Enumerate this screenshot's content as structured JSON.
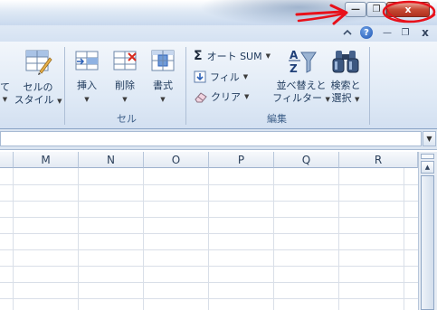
{
  "window": {
    "minimize_glyph": "—",
    "restore_glyph": "❐",
    "close_glyph": "x"
  },
  "ribbon_controls": {
    "help_glyph": "?",
    "minimize_glyph": "—",
    "restore_glyph": "❐",
    "close_glyph": "x"
  },
  "ribbon": {
    "styles_group": {
      "partial_label": "て",
      "cell_style": {
        "line1": "セルの",
        "line2": "スタイル"
      }
    },
    "cells_group": {
      "label": "セル",
      "insert": "挿入",
      "delete": "削除",
      "format": "書式"
    },
    "editing_group": {
      "label": "編集",
      "autosum": "オート SUM",
      "fill": "フィル",
      "clear": "クリア",
      "sort_filter": {
        "line1": "並べ替えと",
        "line2": "フィルター"
      },
      "find_select": {
        "line1": "検索と",
        "line2": "選択"
      }
    }
  },
  "sheet": {
    "columns": [
      "M",
      "N",
      "O",
      "P",
      "Q",
      "R"
    ]
  },
  "colors": {
    "annotation_red": "#e8101a",
    "close_button": "#c74a34",
    "ribbon_bg": "#dde8f5",
    "accent_blue": "#1f56b4"
  },
  "icons": {
    "cell_style": "cell-style-icon",
    "insert": "insert-cells-icon",
    "delete": "delete-cells-icon",
    "format": "format-cells-icon",
    "autosum": "sigma-icon",
    "fill": "fill-down-icon",
    "clear": "eraser-icon",
    "sort_filter": "sort-filter-icon",
    "find_select": "binoculars-icon"
  }
}
